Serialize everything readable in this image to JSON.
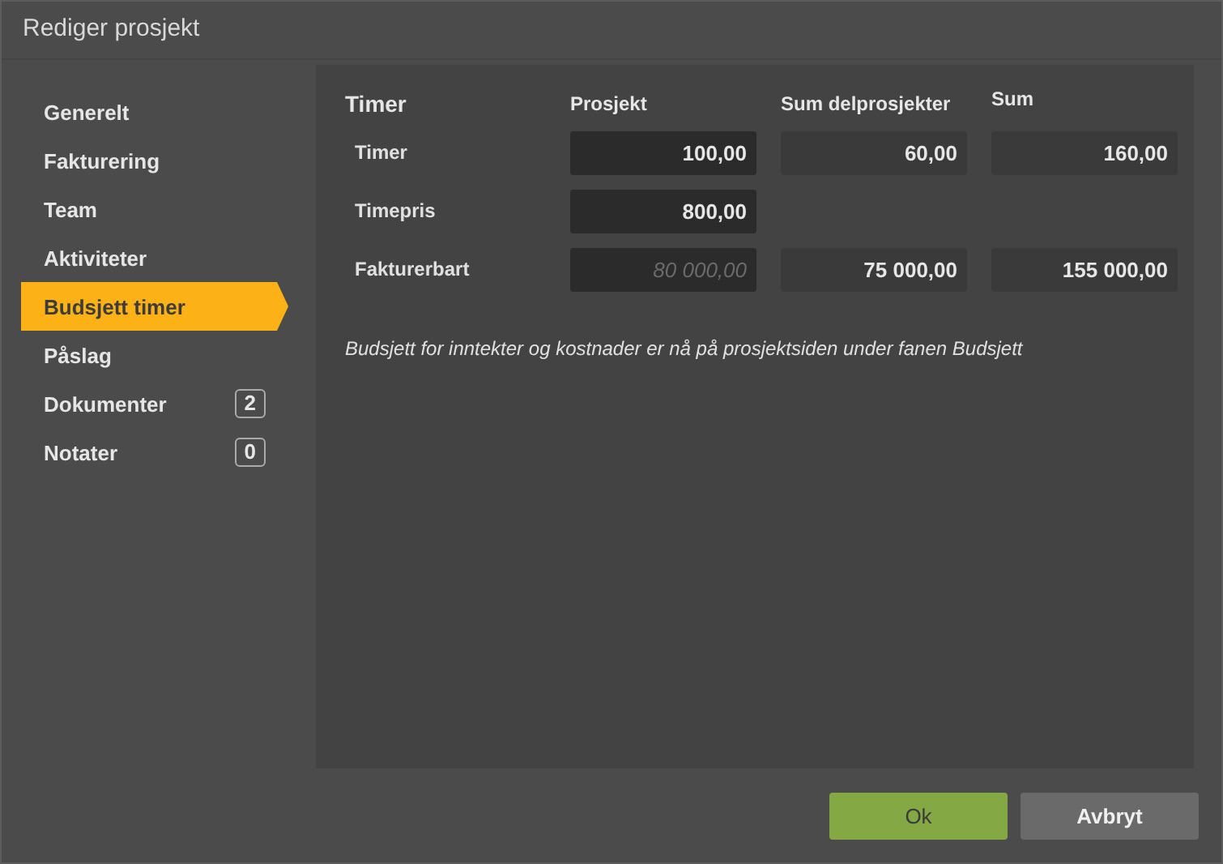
{
  "window": {
    "title": "Rediger prosjekt"
  },
  "sidebar": {
    "items": [
      {
        "label": "Generelt",
        "selected": false
      },
      {
        "label": "Fakturering",
        "selected": false
      },
      {
        "label": "Team",
        "selected": false
      },
      {
        "label": "Aktiviteter",
        "selected": false
      },
      {
        "label": "Budsjett timer",
        "selected": true
      },
      {
        "label": "Påslag",
        "selected": false
      },
      {
        "label": "Dokumenter",
        "selected": false,
        "count": "2"
      },
      {
        "label": "Notater",
        "selected": false,
        "count": "0"
      }
    ]
  },
  "table": {
    "title": "Timer",
    "columns": [
      "Prosjekt",
      "Sum delprosjekter",
      "Sum"
    ],
    "rows": [
      {
        "label": "Timer",
        "cells": [
          {
            "kind": "input",
            "value": "100,00"
          },
          {
            "kind": "readonly",
            "value": "60,00"
          },
          {
            "kind": "readonly",
            "value": "160,00"
          }
        ]
      },
      {
        "label": "Timepris",
        "cells": [
          {
            "kind": "input",
            "value": "800,00"
          },
          {
            "kind": "empty"
          },
          {
            "kind": "empty"
          }
        ]
      },
      {
        "label": "Fakturerbart",
        "cells": [
          {
            "kind": "input",
            "placeholder": "80 000,00"
          },
          {
            "kind": "readonly",
            "value": "75 000,00"
          },
          {
            "kind": "readonly",
            "value": "155 000,00"
          }
        ]
      }
    ]
  },
  "note": "Budsjett for inntekter og kostnader er nå på prosjektsiden under fanen Budsjett",
  "buttons": [
    {
      "label": "Ok",
      "kind": "primary"
    },
    {
      "label": "Avbryt",
      "kind": "secondary"
    }
  ]
}
